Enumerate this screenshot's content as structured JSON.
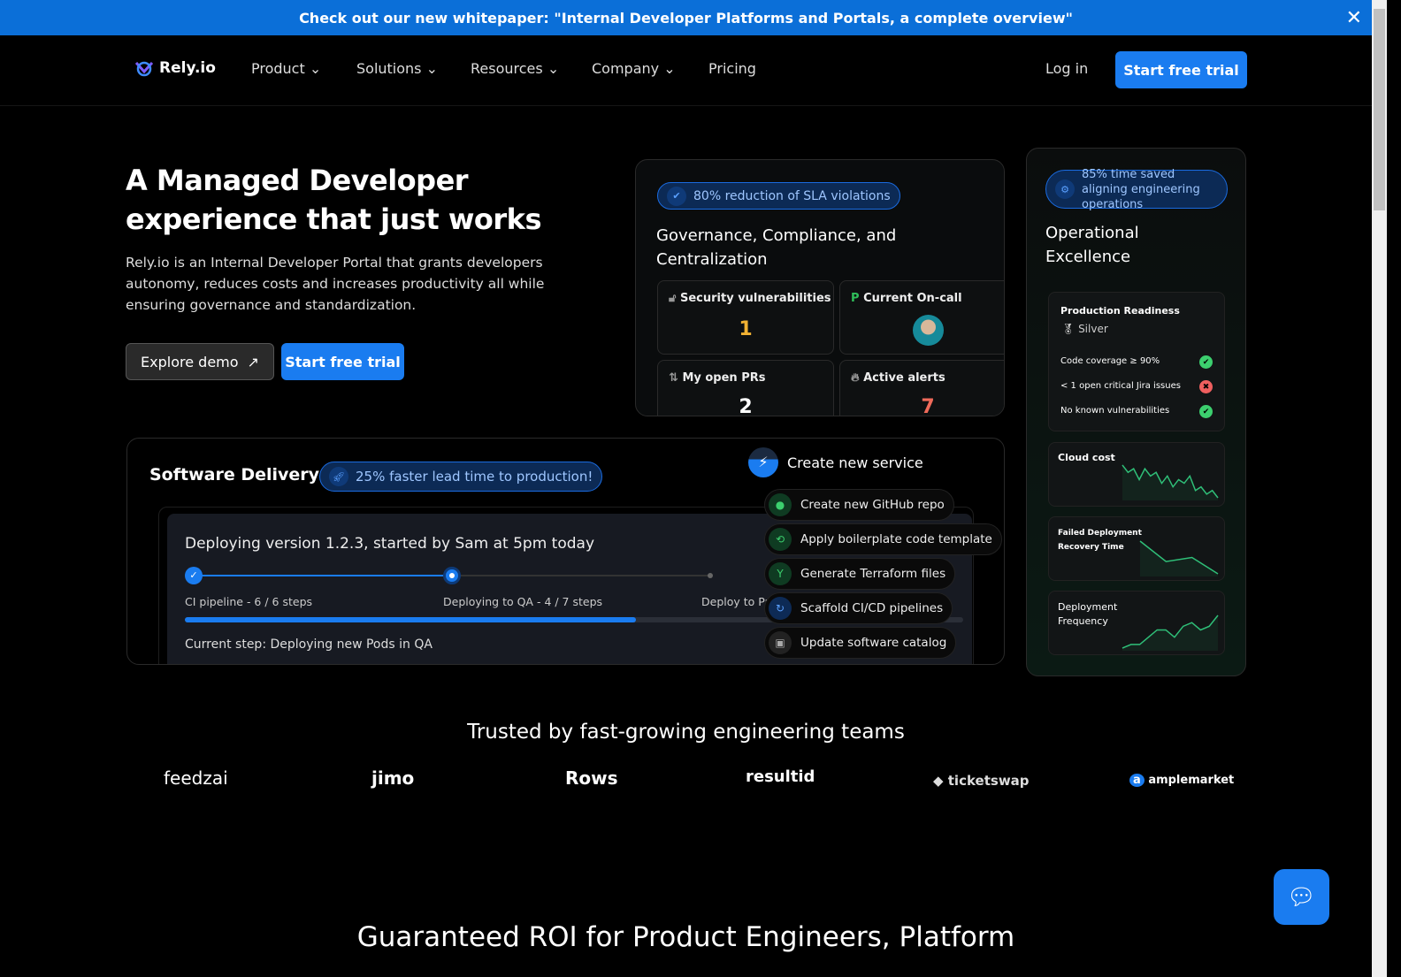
{
  "banner": {
    "text": "Check out our new whitepaper: \"Internal Developer Platforms and Portals, a complete overview\"",
    "close_icon": "close-icon"
  },
  "nav": {
    "logo": "Rely.io",
    "items": [
      "Product",
      "Solutions",
      "Resources",
      "Company",
      "Pricing"
    ],
    "login": "Log in",
    "cta": "Start free trial"
  },
  "hero": {
    "title_1": "A Managed Developer",
    "title_2": "experience that just works",
    "desc": "Rely.io is an Internal Developer Portal that grants developers autonomy, reduces costs and increases productivity all while ensuring governance and standardization.",
    "explore": "Explore demo",
    "trial": "Start free trial"
  },
  "governance": {
    "pill": "80% reduction of SLA violations",
    "title": "Governance, Compliance, and Centralization",
    "cards": [
      {
        "label": "Security vulnerabilities",
        "value": "1",
        "color": "#f2b233"
      },
      {
        "label": "Current On-call"
      },
      {
        "label": "My open PRs",
        "value": "2",
        "color": "#ffffff"
      },
      {
        "label": "Active alerts",
        "value": "7",
        "color": "#ef6a5a"
      }
    ]
  },
  "ops": {
    "pill": "85% time saved aligning engineering operations",
    "title": "Operational Excellence",
    "readiness": {
      "title": "Production Readiness",
      "level": "Silver",
      "checks": [
        {
          "label": "Code coverage ≥ 90%",
          "status": "pass"
        },
        {
          "label": "< 1 open critical Jira issues",
          "status": "fail"
        },
        {
          "label": "No known vulnerabilities",
          "status": "pass"
        }
      ]
    },
    "metrics": [
      {
        "label": "Cloud cost",
        "trend": [
          9,
          7,
          8,
          5,
          8,
          6,
          7,
          4,
          6,
          3,
          5,
          4,
          6,
          2,
          3,
          1,
          2,
          0
        ]
      },
      {
        "label": "Failed Deployment Recovery Time",
        "trend": [
          8,
          3,
          4,
          0
        ]
      },
      {
        "label": "Deployment Frequency",
        "trend": [
          0,
          1,
          1,
          3,
          5,
          5,
          3,
          6,
          7,
          5,
          6,
          9
        ]
      }
    ]
  },
  "delivery": {
    "title": "Software Delivery",
    "pill": "25% faster lead time to production!",
    "deploy_title": "Deploying version 1.2.3, started by Sam at 5pm today",
    "stages": [
      "CI pipeline - 6 / 6 steps",
      "Deploying to QA - 4 / 7 steps",
      "Deploy to Pr"
    ],
    "progress": 0.58,
    "current": "Current step: Deploying new Pods in QA",
    "service_title": "Create new service",
    "steps": [
      "Create new GitHub repo",
      "Apply boilerplate code template",
      "Generate Terraform files",
      "Scaffold CI/CD pipelines",
      "Update software catalog"
    ]
  },
  "trusted": {
    "title": "Trusted by fast-growing engineering teams",
    "logos": [
      "feedzai",
      "jimo",
      "Rows",
      "resultid",
      "ticketswap",
      "amplemarket"
    ]
  },
  "roi": {
    "title": "Guaranteed ROI for Product Engineers, Platform"
  }
}
